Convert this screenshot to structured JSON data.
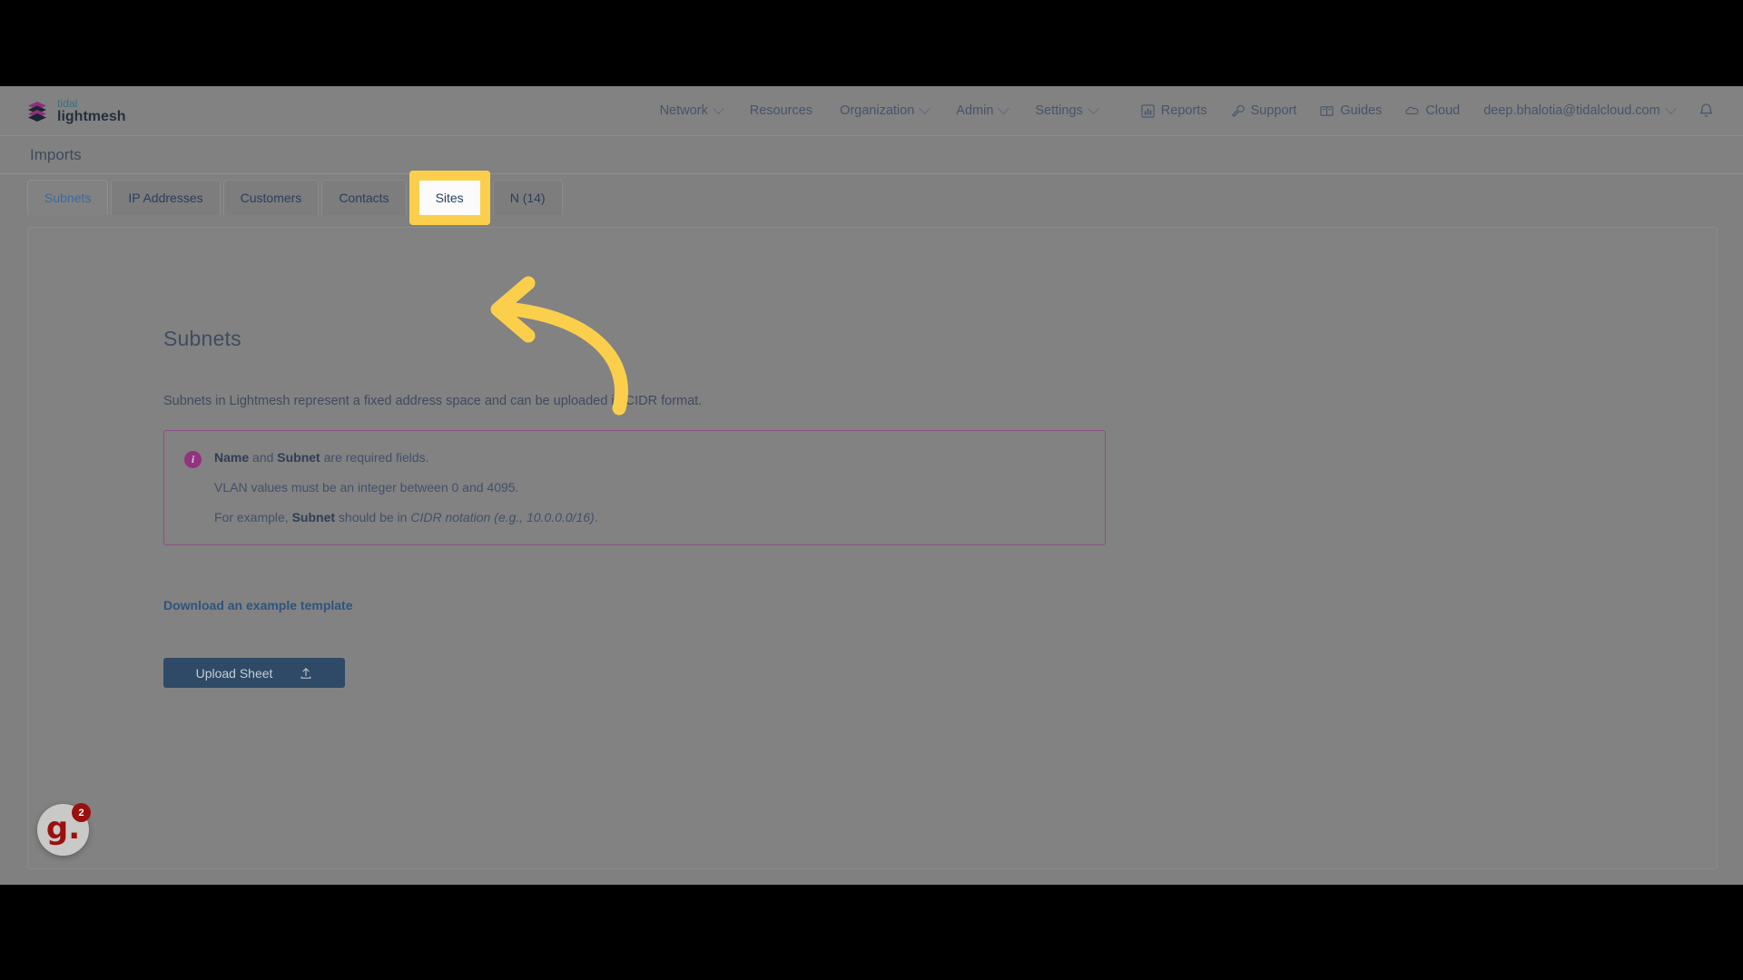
{
  "brand": {
    "top": "tidal",
    "bottom": "lightmesh",
    "logo_icon": "stacked-layers-icon",
    "accent": "#91337f",
    "teal": "#3b6e80"
  },
  "topnav": {
    "main_items": [
      {
        "label": "Network",
        "has_caret": true,
        "icon": null
      },
      {
        "label": "Resources",
        "has_caret": false,
        "icon": null
      },
      {
        "label": "Organization",
        "has_caret": true,
        "icon": null
      },
      {
        "label": "Admin",
        "has_caret": true,
        "icon": null
      },
      {
        "label": "Settings",
        "has_caret": true,
        "icon": null
      }
    ],
    "right_items": [
      {
        "label": "Reports",
        "icon": "bar-chart-icon",
        "has_caret": false
      },
      {
        "label": "Support",
        "icon": "wrench-icon",
        "has_caret": false
      },
      {
        "label": "Guides",
        "icon": "book-icon",
        "has_caret": false
      },
      {
        "label": "Cloud",
        "icon": "cloud-icon",
        "has_caret": false
      },
      {
        "label": "deep.bhalotia@tidalcloud.com",
        "icon": null,
        "has_caret": true
      }
    ],
    "notifications_icon": "bell-icon"
  },
  "page": {
    "header_title": "Imports"
  },
  "tabs": [
    {
      "label": "Subnets",
      "state": "active"
    },
    {
      "label": "IP Addresses",
      "state": "default"
    },
    {
      "label": "Customers",
      "state": "default"
    },
    {
      "label": "Contacts",
      "state": "default"
    },
    {
      "label": "Sites",
      "state": "spotlight"
    },
    {
      "label": "N                    (14)",
      "state": "default"
    }
  ],
  "annotation": {
    "type": "curved-arrow",
    "color": "#fbcf4c",
    "direction": "points-left-to-sites-tab",
    "highlight_target": "Sites"
  },
  "panel": {
    "title": "Subnets",
    "description": "Subnets in Lightmesh represent a fixed address space and can be uploaded in CIDR format.",
    "info": {
      "icon": "info-circle-icon",
      "icon_glyph": "i",
      "border_color": "#8d4f84",
      "lines": [
        {
          "parts": [
            {
              "text": "Name",
              "style": "bold"
            },
            {
              "text": " and ",
              "style": "normal"
            },
            {
              "text": "Subnet",
              "style": "bold"
            },
            {
              "text": " are required fields.",
              "style": "normal"
            }
          ]
        },
        {
          "parts": [
            {
              "text": "VLAN values must be an integer between 0 and 4095.",
              "style": "normal"
            }
          ]
        },
        {
          "parts": [
            {
              "text": "For example, ",
              "style": "normal"
            },
            {
              "text": "Subnet",
              "style": "bold"
            },
            {
              "text": " should be in ",
              "style": "normal"
            },
            {
              "text": "CIDR notation (e.g., 10.0.0.0/16)",
              "style": "italic"
            },
            {
              "text": ".",
              "style": "normal"
            }
          ]
        }
      ]
    },
    "download_link": "Download an example template",
    "upload_button": {
      "label": "Upload Sheet",
      "icon": "upload-icon",
      "color": "#2e4a66"
    }
  },
  "chat_widget": {
    "glyph": "g.",
    "badge_count": "2",
    "color": "#9b0f0f"
  }
}
